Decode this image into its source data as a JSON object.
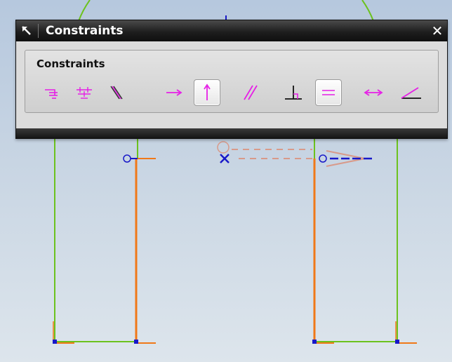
{
  "dialog": {
    "title": "Constraints",
    "group_label": "Constraints",
    "close_label": "✕",
    "buttons": [
      {
        "id": "point-on-curve",
        "icon": "point-on-curve-icon",
        "active": false
      },
      {
        "id": "point-on-string",
        "icon": "point-on-string-icon",
        "active": false
      },
      {
        "id": "collinear",
        "icon": "collinear-icon",
        "active": false
      },
      {
        "id": "horizontal",
        "icon": "horizontal-icon",
        "active": false
      },
      {
        "id": "vertical",
        "icon": "vertical-icon",
        "active": true
      },
      {
        "id": "parallel",
        "icon": "parallel-icon",
        "active": false
      },
      {
        "id": "perpendicular",
        "icon": "perpendicular-icon",
        "active": false
      },
      {
        "id": "equal-length",
        "icon": "equal-length-icon",
        "active": true
      },
      {
        "id": "constant-length",
        "icon": "constant-length-icon",
        "active": false
      },
      {
        "id": "constant-angle",
        "icon": "constant-angle-icon",
        "active": false
      }
    ]
  },
  "colors": {
    "constraint_icon": "#e61fe6",
    "sketch_green": "#6cc21e",
    "sketch_orange": "#f07818",
    "sketch_blue": "#1818c8",
    "dimension_salmon": "#d89a8a"
  }
}
